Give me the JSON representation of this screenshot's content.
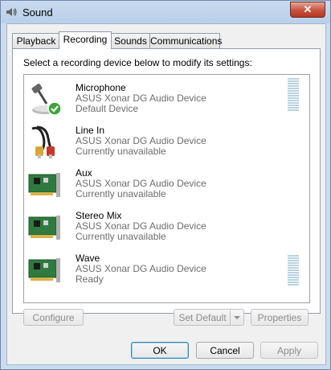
{
  "window": {
    "title": "Sound",
    "close_label": "✕"
  },
  "tabs": [
    {
      "label": "Playback"
    },
    {
      "label": "Recording"
    },
    {
      "label": "Sounds"
    },
    {
      "label": "Communications"
    }
  ],
  "panel": {
    "instruction": "Select a recording device below to modify its settings:"
  },
  "devices": [
    {
      "name": "Microphone",
      "device": "ASUS Xonar DG Audio Device",
      "status": "Default Device",
      "icon": "microphone-icon",
      "is_default": true
    },
    {
      "name": "Line In",
      "device": "ASUS Xonar DG Audio Device",
      "status": "Currently unavailable",
      "icon": "rca-cable-icon"
    },
    {
      "name": "Aux",
      "device": "ASUS Xonar DG Audio Device",
      "status": "Currently unavailable",
      "icon": "sound-card-icon"
    },
    {
      "name": "Stereo Mix",
      "device": "ASUS Xonar DG Audio Device",
      "status": "Currently unavailable",
      "icon": "sound-card-icon"
    },
    {
      "name": "Wave",
      "device": "ASUS Xonar DG Audio Device",
      "status": "Ready",
      "icon": "sound-card-icon"
    }
  ],
  "buttons": {
    "configure": "Configure",
    "set_default": "Set Default",
    "properties": "Properties",
    "ok": "OK",
    "cancel": "Cancel",
    "apply": "Apply"
  },
  "colors": {
    "titlebar": "#b9cfe9",
    "close": "#c7523f",
    "meter": "#b9d3e0",
    "check": "#3aa63a"
  }
}
